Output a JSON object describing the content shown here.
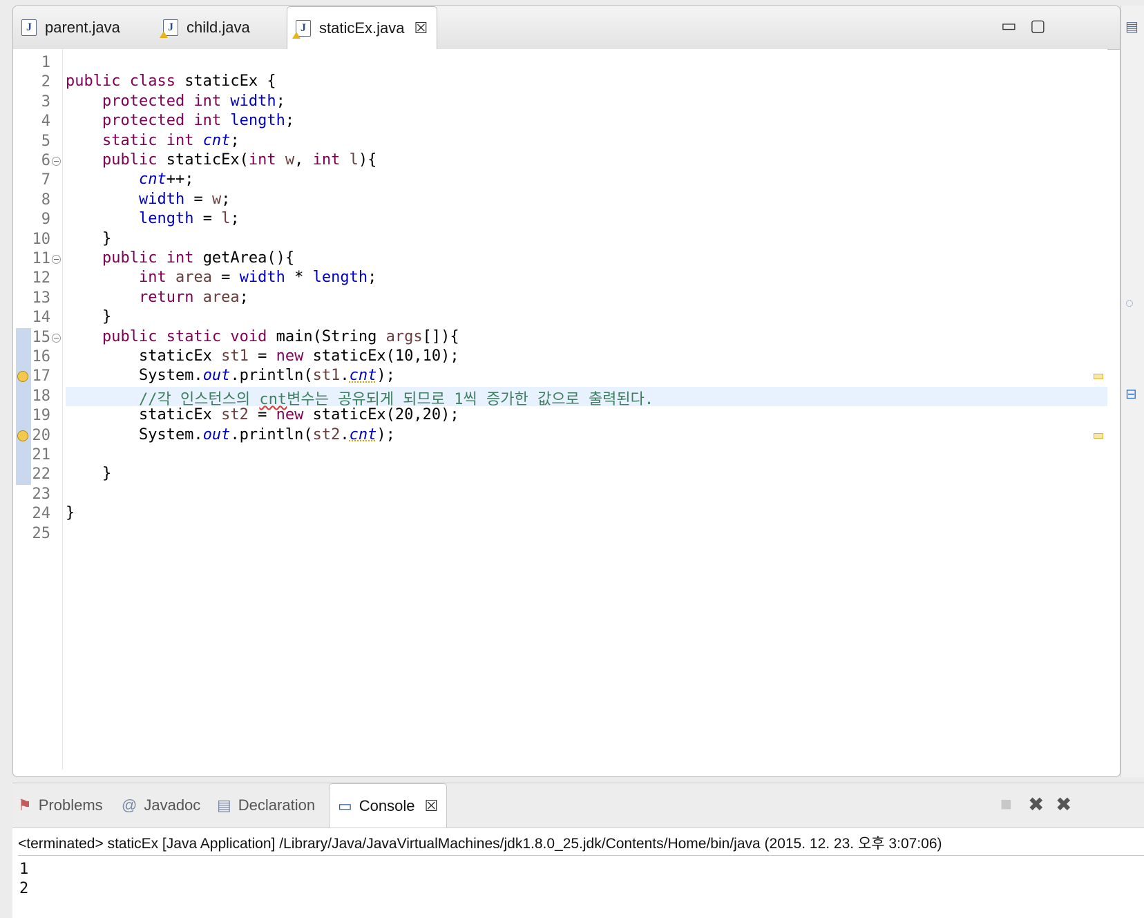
{
  "editor": {
    "tabs": [
      {
        "label": "parent.java",
        "icon": "java-file-icon",
        "active": false,
        "warning": false
      },
      {
        "label": "child.java",
        "icon": "java-file-icon",
        "active": false,
        "warning": true
      },
      {
        "label": "staticEx.java",
        "icon": "java-file-icon",
        "active": true,
        "warning": true
      }
    ],
    "close_glyph": "☒",
    "line_numbers": [
      "1",
      "2",
      "3",
      "4",
      "5",
      "6",
      "7",
      "8",
      "9",
      "10",
      "11",
      "12",
      "13",
      "14",
      "15",
      "16",
      "17",
      "18",
      "19",
      "20",
      "21",
      "22",
      "23",
      "24",
      "25"
    ],
    "current_line": 18,
    "folded_lines": [
      6,
      11,
      15
    ],
    "warning_lines": [
      17,
      20
    ],
    "code_lines": [
      [],
      [
        {
          "t": "public class ",
          "s": "k"
        },
        {
          "t": "staticEx {",
          "s": ""
        }
      ],
      [
        {
          "t": "    ",
          "s": ""
        },
        {
          "t": "protected int ",
          "s": "k"
        },
        {
          "t": "width",
          "s": "f"
        },
        {
          "t": ";",
          "s": ""
        }
      ],
      [
        {
          "t": "    ",
          "s": ""
        },
        {
          "t": "protected int ",
          "s": "k"
        },
        {
          "t": "length",
          "s": "f"
        },
        {
          "t": ";",
          "s": ""
        }
      ],
      [
        {
          "t": "    ",
          "s": ""
        },
        {
          "t": "static int ",
          "s": "k"
        },
        {
          "t": "cnt",
          "s": "sf"
        },
        {
          "t": ";",
          "s": ""
        }
      ],
      [
        {
          "t": "    ",
          "s": ""
        },
        {
          "t": "public ",
          "s": "k"
        },
        {
          "t": "staticEx(",
          "s": ""
        },
        {
          "t": "int ",
          "s": "k"
        },
        {
          "t": "w",
          "s": "lv"
        },
        {
          "t": ", ",
          "s": ""
        },
        {
          "t": "int ",
          "s": "k"
        },
        {
          "t": "l",
          "s": "lv"
        },
        {
          "t": "){",
          "s": ""
        }
      ],
      [
        {
          "t": "        ",
          "s": ""
        },
        {
          "t": "cnt",
          "s": "sf"
        },
        {
          "t": "++;",
          "s": ""
        }
      ],
      [
        {
          "t": "        ",
          "s": ""
        },
        {
          "t": "width",
          "s": "f"
        },
        {
          "t": " = ",
          "s": ""
        },
        {
          "t": "w",
          "s": "lv"
        },
        {
          "t": ";",
          "s": ""
        }
      ],
      [
        {
          "t": "        ",
          "s": ""
        },
        {
          "t": "length",
          "s": "f"
        },
        {
          "t": " = ",
          "s": ""
        },
        {
          "t": "l",
          "s": "lv"
        },
        {
          "t": ";",
          "s": ""
        }
      ],
      [
        {
          "t": "    }",
          "s": ""
        }
      ],
      [
        {
          "t": "    ",
          "s": ""
        },
        {
          "t": "public int ",
          "s": "k"
        },
        {
          "t": "getArea(){",
          "s": ""
        }
      ],
      [
        {
          "t": "        ",
          "s": ""
        },
        {
          "t": "int ",
          "s": "k"
        },
        {
          "t": "area",
          "s": "lv"
        },
        {
          "t": " = ",
          "s": ""
        },
        {
          "t": "width",
          "s": "f"
        },
        {
          "t": " * ",
          "s": ""
        },
        {
          "t": "length",
          "s": "f"
        },
        {
          "t": ";",
          "s": ""
        }
      ],
      [
        {
          "t": "        ",
          "s": ""
        },
        {
          "t": "return ",
          "s": "k"
        },
        {
          "t": "area",
          "s": "lv"
        },
        {
          "t": ";",
          "s": ""
        }
      ],
      [
        {
          "t": "    }",
          "s": ""
        }
      ],
      [
        {
          "t": "    ",
          "s": ""
        },
        {
          "t": "public static void ",
          "s": "k"
        },
        {
          "t": "main(String ",
          "s": ""
        },
        {
          "t": "args",
          "s": "lv"
        },
        {
          "t": "[]){",
          "s": ""
        }
      ],
      [
        {
          "t": "        staticEx ",
          "s": ""
        },
        {
          "t": "st1",
          "s": "lv"
        },
        {
          "t": " = ",
          "s": ""
        },
        {
          "t": "new ",
          "s": "k"
        },
        {
          "t": "staticEx(10,10);",
          "s": ""
        }
      ],
      [
        {
          "t": "        System.",
          "s": ""
        },
        {
          "t": "out",
          "s": "sf"
        },
        {
          "t": ".println(",
          "s": ""
        },
        {
          "t": "st1",
          "s": "lv"
        },
        {
          "t": ".",
          "s": ""
        },
        {
          "t": "cnt",
          "s": "sf wrn"
        },
        {
          "t": ");",
          "s": ""
        }
      ],
      [
        {
          "t": "        ",
          "s": ""
        },
        {
          "t": "//각 인스턴스의 ",
          "s": "c"
        },
        {
          "t": "cnt",
          "s": "c err"
        },
        {
          "t": "변수는 공유되게 되므로 1씩 증가한 값으로 출력된다.",
          "s": "c"
        }
      ],
      [
        {
          "t": "        staticEx ",
          "s": ""
        },
        {
          "t": "st2",
          "s": "lv"
        },
        {
          "t": " = ",
          "s": ""
        },
        {
          "t": "new ",
          "s": "k"
        },
        {
          "t": "staticEx(20,20);",
          "s": ""
        }
      ],
      [
        {
          "t": "        System.",
          "s": ""
        },
        {
          "t": "out",
          "s": "sf"
        },
        {
          "t": ".println(",
          "s": ""
        },
        {
          "t": "st2",
          "s": "lv"
        },
        {
          "t": ".",
          "s": ""
        },
        {
          "t": "cnt",
          "s": "sf wrn"
        },
        {
          "t": ");",
          "s": ""
        }
      ],
      [],
      [
        {
          "t": "    }",
          "s": ""
        }
      ],
      [],
      [
        {
          "t": "}",
          "s": ""
        }
      ],
      []
    ]
  },
  "console": {
    "tabs": [
      {
        "label": "Problems",
        "icon": "problems-icon",
        "glyph": "⚑",
        "active": false
      },
      {
        "label": "Javadoc",
        "icon": "javadoc-icon",
        "glyph": "@",
        "active": false
      },
      {
        "label": "Declaration",
        "icon": "declaration-icon",
        "glyph": "▤",
        "active": false
      },
      {
        "label": "Console",
        "icon": "console-icon",
        "glyph": "▭",
        "active": true
      }
    ],
    "close_glyph": "☒",
    "header": "<terminated> staticEx [Java Application] /Library/Java/JavaVirtualMachines/jdk1.8.0_25.jdk/Contents/Home/bin/java (2015. 12. 23. 오후 3:07:06)",
    "output_lines": [
      "1",
      "2"
    ]
  },
  "colors": {
    "keyword": "#7f0055",
    "field": "#0000c0",
    "comment": "#3f7f5f",
    "local_var": "#6a3e3e",
    "current_line_bg": "#e8f2fe"
  }
}
